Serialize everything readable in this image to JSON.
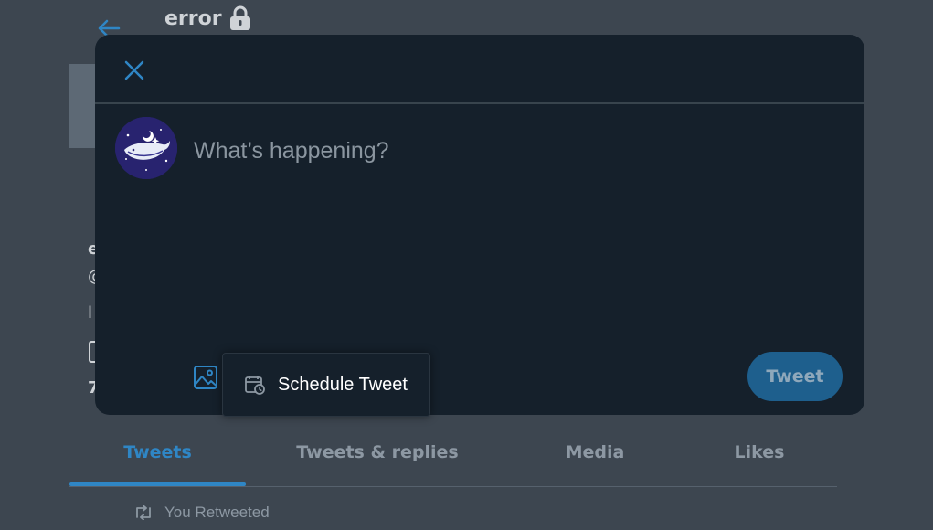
{
  "header": {
    "title": "error",
    "back_icon": "arrow-left-icon",
    "lock_icon": "lock-icon"
  },
  "profile": {
    "name_fragment": "e",
    "handle_fragment": "@",
    "bio_fragment": "l",
    "count_fragment": "7"
  },
  "tabs": [
    {
      "label": "Tweets",
      "active": true
    },
    {
      "label": "Tweets & replies",
      "active": false
    },
    {
      "label": "Media",
      "active": false
    },
    {
      "label": "Likes",
      "active": false
    }
  ],
  "timeline": {
    "retweet_text": "You Retweeted"
  },
  "compose_modal": {
    "placeholder": "What’s happening?",
    "value": "",
    "tooltip": "Schedule Tweet",
    "tweet_button": "Tweet",
    "icons": {
      "close": "close-icon",
      "avatar": "whale-avatar",
      "media": "image-icon",
      "schedule": "calendar-clock-icon"
    }
  },
  "colors": {
    "accent": "#2f86c5",
    "modal_bg": "#15202b",
    "overlay_bg": "#3d4650",
    "tweet_button_disabled": "#1e5f8d"
  }
}
